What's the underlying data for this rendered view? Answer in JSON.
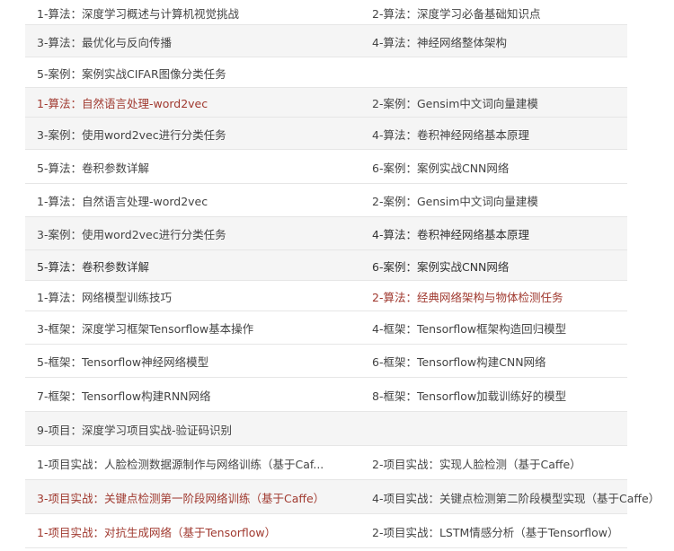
{
  "rows": [
    {
      "left": "1-算法：深度学习概述与计算机视觉挑战",
      "right": "2-算法：深度学习必备基础知识点"
    },
    {
      "left": "3-算法：最优化与反向传播",
      "right": "4-算法：神经网络整体架构"
    },
    {
      "left": "5-案例：案例实战CIFAR图像分类任务",
      "right": ""
    },
    {
      "left": "1-算法：自然语言处理-word2vec",
      "right": "2-案例：Gensim中文词向量建模"
    },
    {
      "left": "3-案例：使用word2vec进行分类任务",
      "right": "4-算法：卷积神经网络基本原理"
    },
    {
      "left": "5-算法：卷积参数详解",
      "right": "6-案例：案例实战CNN网络"
    },
    {
      "left": "1-算法：自然语言处理-word2vec",
      "right": "2-案例：Gensim中文词向量建模"
    },
    {
      "left": "3-案例：使用word2vec进行分类任务",
      "right": "4-算法：卷积神经网络基本原理"
    },
    {
      "left": "5-算法：卷积参数详解",
      "right": "6-案例：案例实战CNN网络"
    },
    {
      "left": "1-算法：网络模型训练技巧",
      "right": "2-算法：经典网络架构与物体检测任务"
    },
    {
      "left": "3-框架：深度学习框架Tensorflow基本操作",
      "right": "4-框架：Tensorflow框架构造回归模型"
    },
    {
      "left": "5-框架：Tensorflow神经网络模型",
      "right": "6-框架：Tensorflow构建CNN网络"
    },
    {
      "left": "7-框架：Tensorflow构建RNN网络",
      "right": "8-框架：Tensorflow加载训练好的模型"
    },
    {
      "left": "9-项目：深度学习项目实战-验证码识别",
      "right": ""
    },
    {
      "left": "1-项目实战：人脸检测数据源制作与网络训练（基于Caf...",
      "right": "2-项目实战：实现人脸检测（基于Caffe）"
    },
    {
      "left": "3-项目实战：关键点检测第一阶段网络训练（基于Caffe）",
      "right": "4-项目实战：关键点检测第二阶段模型实现（基于Caffe）"
    },
    {
      "left": "1-项目实战：对抗生成网络（基于Tensorflow）",
      "right": "2-项目实战：LSTM情感分析（基于Tensorflow）"
    }
  ]
}
